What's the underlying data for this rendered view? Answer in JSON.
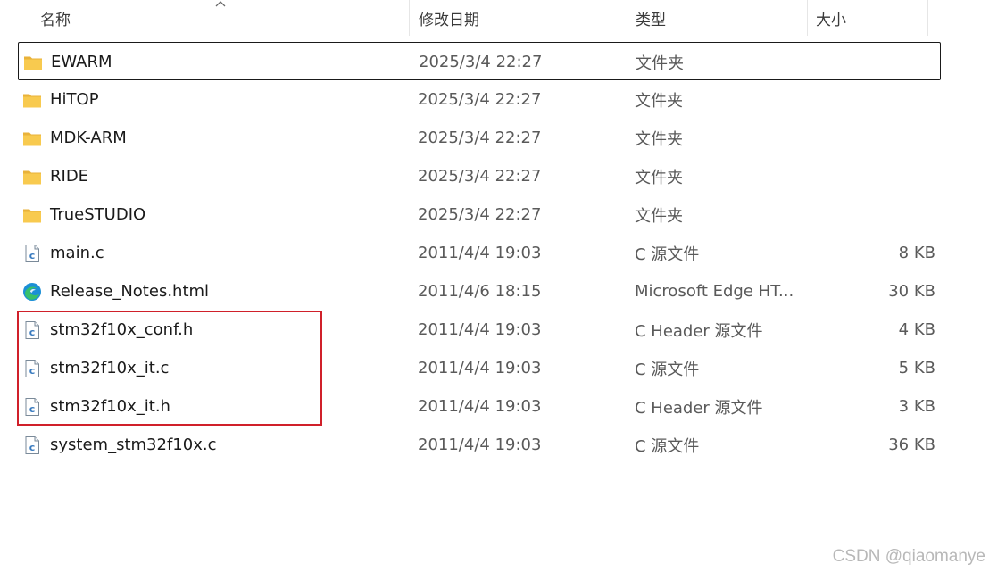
{
  "columns": {
    "name": "名称",
    "date": "修改日期",
    "type": "类型",
    "size": "大小"
  },
  "files": [
    {
      "name": "EWARM",
      "date": "2025/3/4 22:27",
      "type": "文件夹",
      "size": "",
      "icon": "folder-icon",
      "focused": true
    },
    {
      "name": "HiTOP",
      "date": "2025/3/4 22:27",
      "type": "文件夹",
      "size": "",
      "icon": "folder-icon"
    },
    {
      "name": "MDK-ARM",
      "date": "2025/3/4 22:27",
      "type": "文件夹",
      "size": "",
      "icon": "folder-icon"
    },
    {
      "name": "RIDE",
      "date": "2025/3/4 22:27",
      "type": "文件夹",
      "size": "",
      "icon": "folder-icon"
    },
    {
      "name": "TrueSTUDIO",
      "date": "2025/3/4 22:27",
      "type": "文件夹",
      "size": "",
      "icon": "folder-icon"
    },
    {
      "name": "main.c",
      "date": "2011/4/4 19:03",
      "type": "C 源文件",
      "size": "8 KB",
      "icon": "c-file-icon"
    },
    {
      "name": "Release_Notes.html",
      "date": "2011/4/6 18:15",
      "type": "Microsoft Edge HT...",
      "size": "30 KB",
      "icon": "edge-icon"
    },
    {
      "name": "stm32f10x_conf.h",
      "date": "2011/4/4 19:03",
      "type": "C Header 源文件",
      "size": "4 KB",
      "icon": "c-file-icon"
    },
    {
      "name": "stm32f10x_it.c",
      "date": "2011/4/4 19:03",
      "type": "C 源文件",
      "size": "5 KB",
      "icon": "c-file-icon"
    },
    {
      "name": "stm32f10x_it.h",
      "date": "2011/4/4 19:03",
      "type": "C Header 源文件",
      "size": "3 KB",
      "icon": "c-file-icon"
    },
    {
      "name": "system_stm32f10x.c",
      "date": "2011/4/4 19:03",
      "type": "C 源文件",
      "size": "36 KB",
      "icon": "c-file-icon"
    }
  ],
  "watermark": "CSDN @qiaomanye",
  "colors": {
    "highlight": "#d0202a",
    "folder": "#f7c948",
    "c_file_accent": "#3a7bbf"
  }
}
